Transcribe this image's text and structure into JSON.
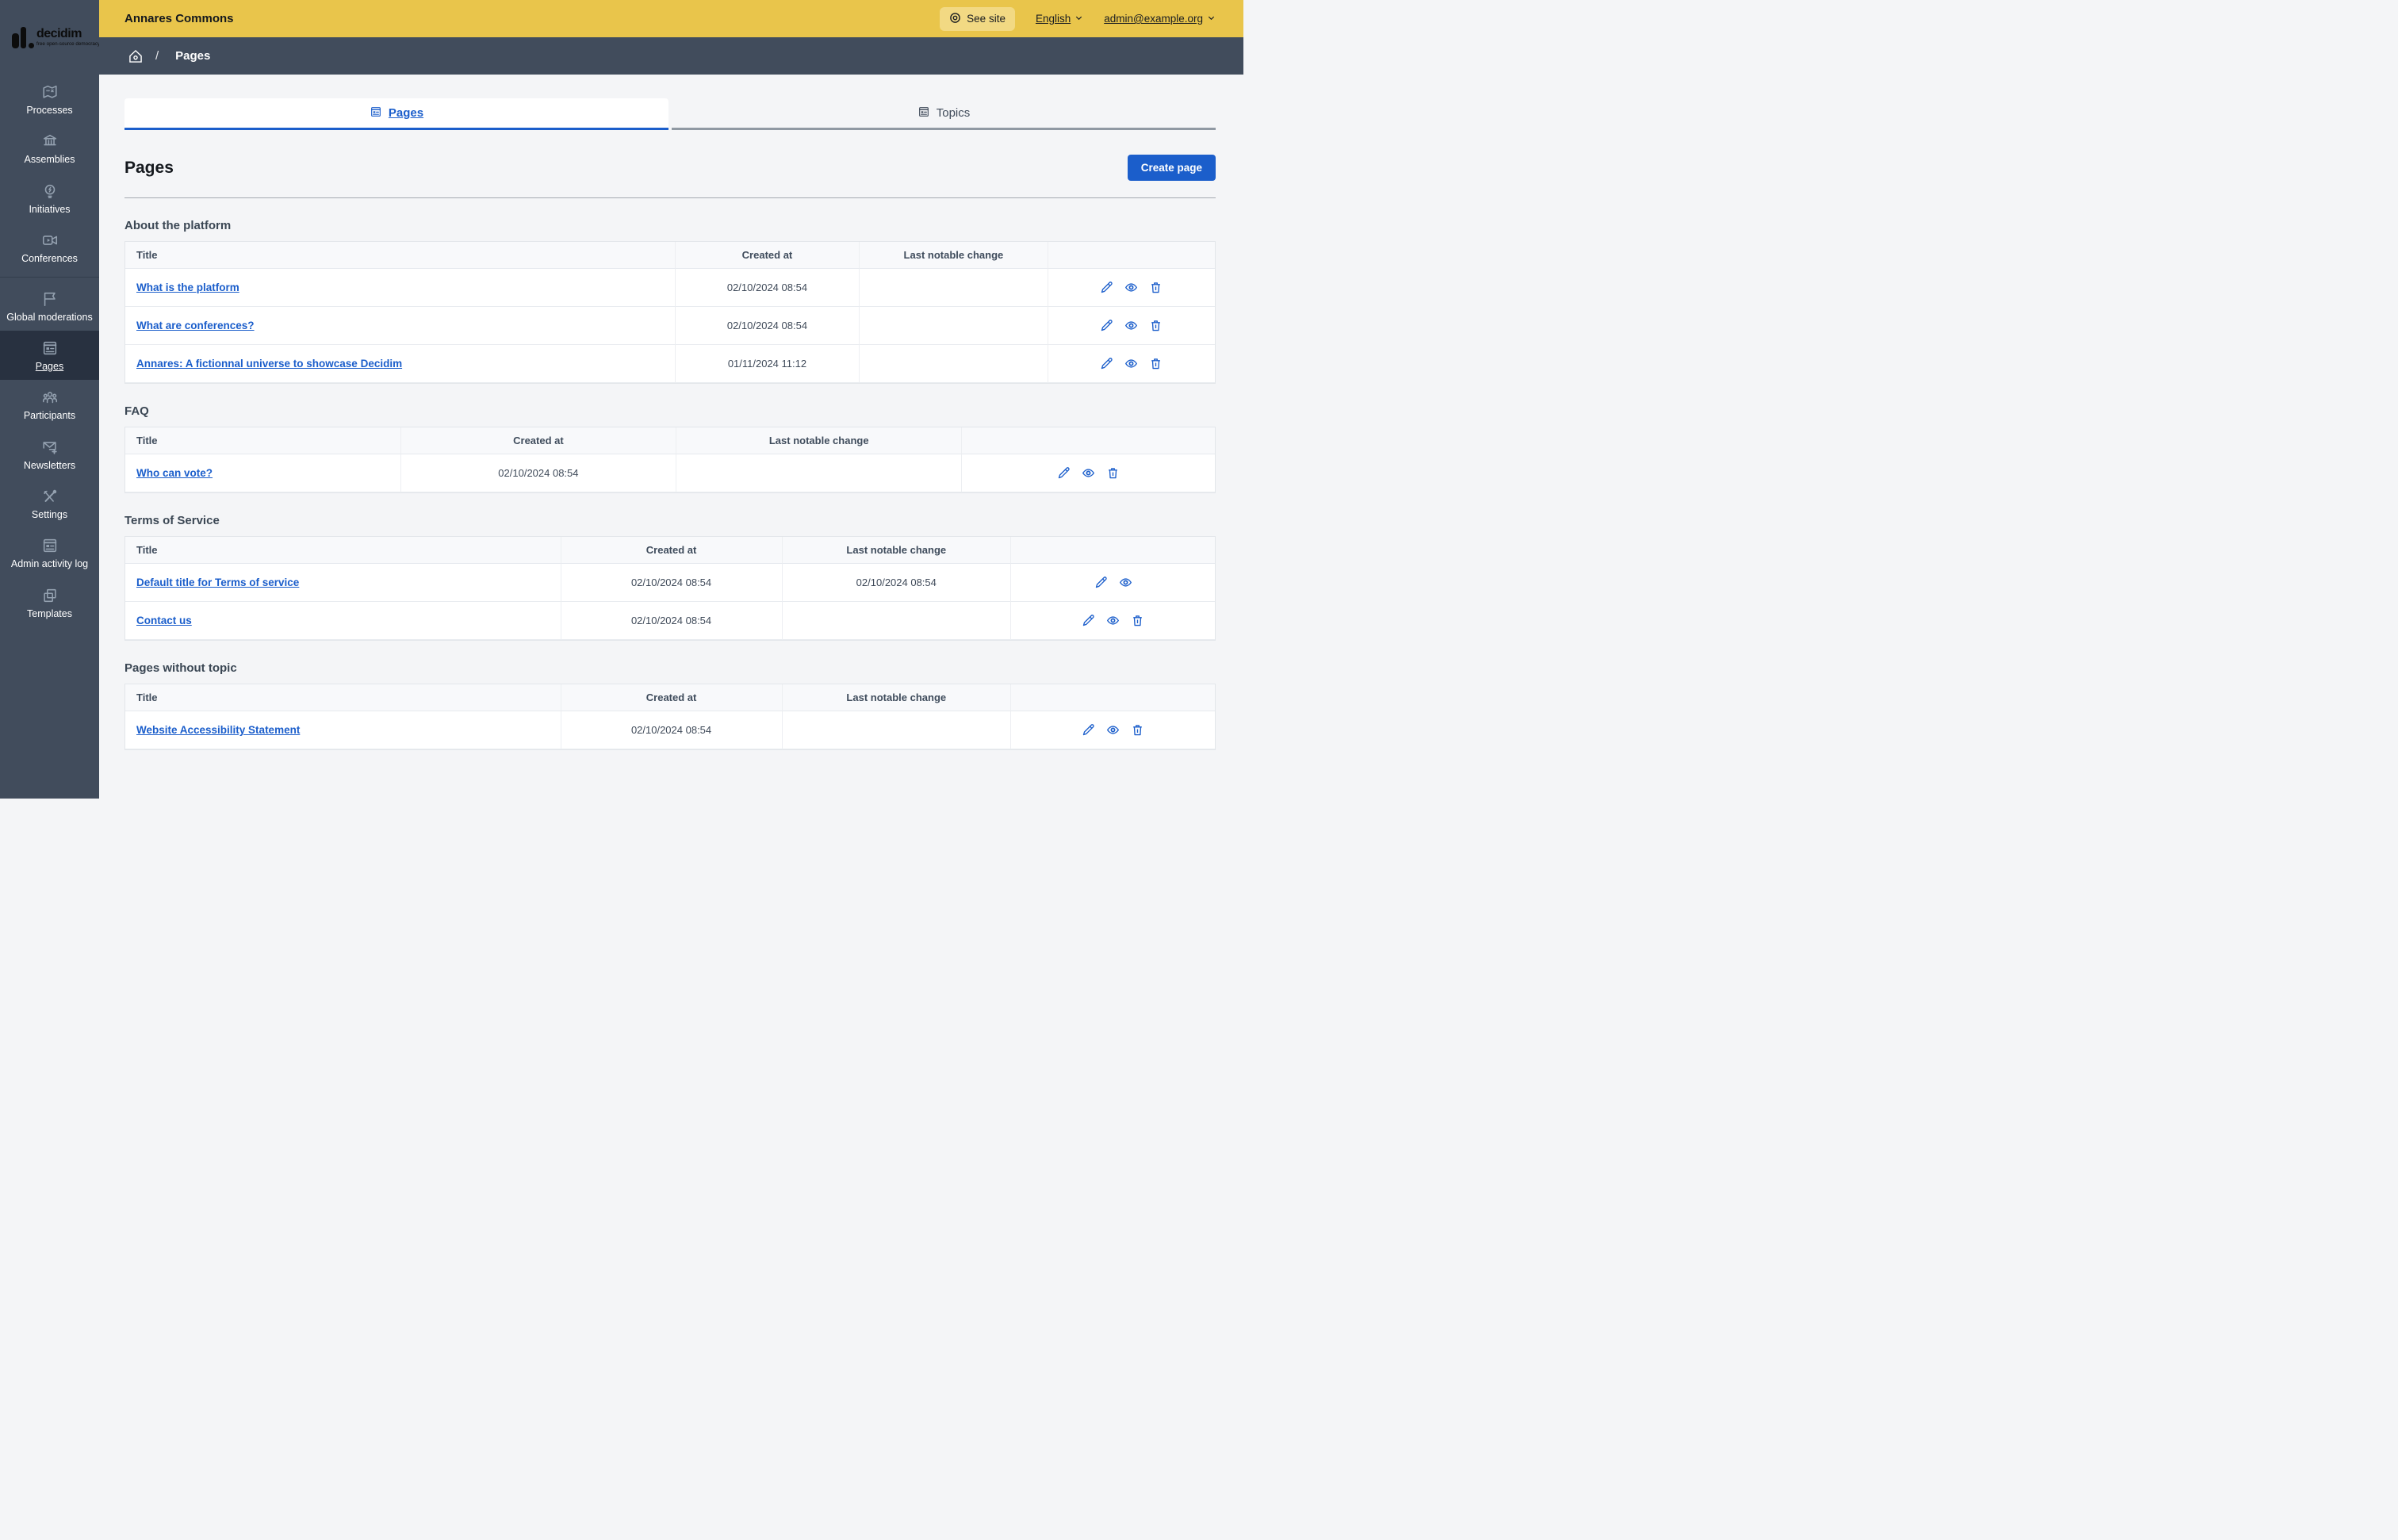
{
  "colors": {
    "accent_blue": "#1b5ecb",
    "topbar_yellow": "#e9c54b",
    "sidebar_slate": "#414c5c",
    "sidebar_active": "#283140"
  },
  "logo": {
    "brand": "decidim",
    "tagline": "free open-source democracy"
  },
  "topbar": {
    "org_name": "Annares Commons",
    "see_site_label": "See site",
    "language_label": "English",
    "account_label": "admin@example.org"
  },
  "breadcrumb": {
    "separator": "/",
    "current": "Pages"
  },
  "sidebar": {
    "groups": [
      {
        "items": [
          {
            "label": "Processes",
            "icon": "map"
          },
          {
            "label": "Assemblies",
            "icon": "building"
          },
          {
            "label": "Initiatives",
            "icon": "lightbulb"
          },
          {
            "label": "Conferences",
            "icon": "video-camera"
          }
        ]
      },
      {
        "items": [
          {
            "label": "Global moderations",
            "icon": "flag"
          },
          {
            "label": "Pages",
            "icon": "article",
            "active": true
          },
          {
            "label": "Participants",
            "icon": "people"
          },
          {
            "label": "Newsletters",
            "icon": "mail-add"
          },
          {
            "label": "Settings",
            "icon": "tools"
          },
          {
            "label": "Admin activity log",
            "icon": "article"
          },
          {
            "label": "Templates",
            "icon": "copy"
          }
        ]
      }
    ]
  },
  "tabs": [
    {
      "label": "Pages",
      "icon": "article",
      "active": true
    },
    {
      "label": "Topics",
      "icon": "article",
      "active": false
    }
  ],
  "page": {
    "title": "Pages",
    "create_button": "Create page"
  },
  "table_columns": [
    "Title",
    "Created at",
    "Last notable change"
  ],
  "sections": [
    {
      "heading": "About the platform",
      "rows": [
        {
          "title": "What is the platform",
          "created_at": "02/10/2024 08:54",
          "last_change": "",
          "actions": [
            "edit",
            "preview",
            "delete"
          ]
        },
        {
          "title": "What are conferences?",
          "created_at": "02/10/2024 08:54",
          "last_change": "",
          "actions": [
            "edit",
            "preview",
            "delete"
          ]
        },
        {
          "title": "Annares: A fictionnal universe to showcase Decidim",
          "created_at": "01/11/2024 11:12",
          "last_change": "",
          "actions": [
            "edit",
            "preview",
            "delete"
          ]
        }
      ]
    },
    {
      "heading": "FAQ",
      "rows": [
        {
          "title": "Who can vote?",
          "created_at": "02/10/2024 08:54",
          "last_change": "",
          "actions": [
            "edit",
            "preview",
            "delete"
          ]
        }
      ]
    },
    {
      "heading": "Terms of Service",
      "rows": [
        {
          "title": "Default title for Terms of service",
          "created_at": "02/10/2024 08:54",
          "last_change": "02/10/2024 08:54",
          "actions": [
            "edit",
            "preview"
          ]
        },
        {
          "title": "Contact us",
          "created_at": "02/10/2024 08:54",
          "last_change": "",
          "actions": [
            "edit",
            "preview",
            "delete"
          ]
        }
      ]
    },
    {
      "heading": "Pages without topic",
      "rows": [
        {
          "title": "Website Accessibility Statement",
          "created_at": "02/10/2024 08:54",
          "last_change": "",
          "actions": [
            "edit",
            "preview",
            "delete"
          ]
        }
      ]
    }
  ]
}
